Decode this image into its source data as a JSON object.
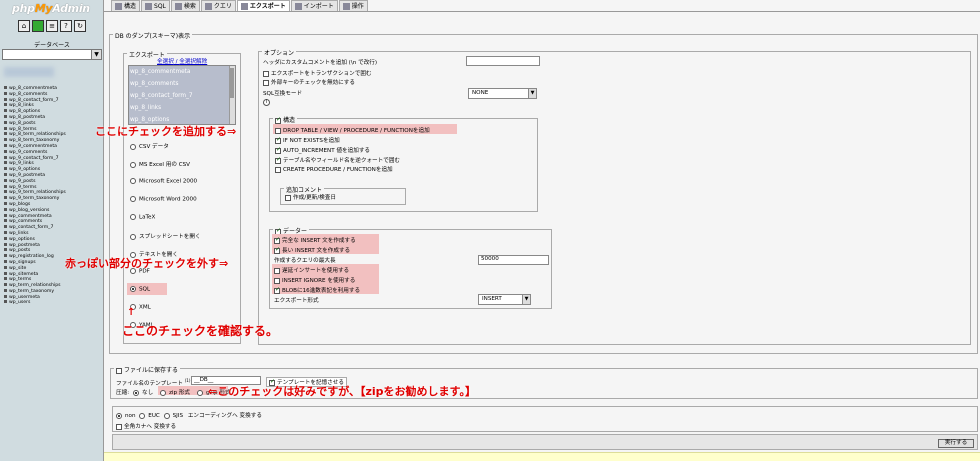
{
  "app": {
    "logo_prefix": "php",
    "logo_mid": "My",
    "logo_suffix": "Admin"
  },
  "left": {
    "db_label": "データベース",
    "icons": [
      "home-icon",
      "sql-window-icon",
      "docs-icon",
      "query-icon",
      "reload-icon"
    ],
    "tables": [
      "wp_8_commentmeta",
      "wp_8_comments",
      "wp_8_contact_form_7",
      "wp_8_links",
      "wp_8_options",
      "wp_8_postmeta",
      "wp_8_posts",
      "wp_8_terms",
      "wp_8_term_relationships",
      "wp_8_term_taxonomy",
      "wp_9_commentmeta",
      "wp_9_comments",
      "wp_9_contact_form_7",
      "wp_9_links",
      "wp_9_options",
      "wp_9_postmeta",
      "wp_9_posts",
      "wp_9_terms",
      "wp_9_term_relationships",
      "wp_9_term_taxonomy",
      "wp_blogs",
      "wp_blog_versions",
      "wp_commentmeta",
      "wp_comments",
      "wp_contact_form_7",
      "wp_links",
      "wp_options",
      "wp_postmeta",
      "wp_posts",
      "wp_registration_log",
      "wp_signups",
      "wp_site",
      "wp_sitemeta",
      "wp_terms",
      "wp_term_relationships",
      "wp_term_taxonomy",
      "wp_usermeta",
      "wp_users"
    ]
  },
  "tabs": [
    {
      "label": "構造",
      "active": false
    },
    {
      "label": "SQL",
      "active": false
    },
    {
      "label": "検索",
      "active": false
    },
    {
      "label": "クエリ",
      "active": false
    },
    {
      "label": "エクスポート",
      "active": true
    },
    {
      "label": "インポート",
      "active": false
    },
    {
      "label": "操作",
      "active": false
    }
  ],
  "dump": {
    "legend": "DB のダンプ(スキーマ)表示",
    "export_legend": "エクスポート",
    "select_all": "全選択",
    "sep": " / ",
    "deselect_all": "全選択解除",
    "table_items": [
      "wp_8_commentmeta",
      "wp_8_comments",
      "wp_8_contact_form_7",
      "wp_8_links",
      "wp_8_options"
    ],
    "formats": [
      "CSV データ",
      "MS Excel 用の CSV",
      "Microsoft Excel 2000",
      "Microsoft Word 2000",
      "LaTeX",
      "スプレッドシートを開く",
      "テキストを開く",
      "PDF",
      "SQL",
      "XML",
      "YAML"
    ],
    "selected_format": "SQL"
  },
  "options": {
    "legend": "オプション",
    "header_comment": "ヘッダにカスタムコメントを追加 (\\n で改行)",
    "transaction": "エクスポートをトランザクションで囲む",
    "fk_checks": "外部キーのチェックを無効にする",
    "compat_mode": "SQL互換モード",
    "compat_value": "NONE",
    "info": "i",
    "structure_legend": "構造",
    "drop_table": "DROP TABLE / VIEW / PROCEDURE / FUNCTIONを追加",
    "if_not_exists": "IF NOT EXISTSを追加",
    "auto_increment": "AUTO_INCREMENT 値を追加する",
    "backquotes": "テーブル名やフィールド名を逆クォートで囲む",
    "create_proc": "CREATE PROCEDURE / FUNCTIONを追加",
    "comment_legend": "追加コメント",
    "comment_dates": "作成/更新/検査日",
    "data_legend": "データー",
    "complete_insert": "完全な INSERT 文を作成する",
    "extended_insert": "長い INSERT 文を作成する",
    "max_query": "作成するクエリの最大長",
    "max_query_value": "50000",
    "delayed": "遅延インサートを使用する",
    "ignore": "INSERT IGNORE を使用する",
    "hex_blob": "BLOBに16進数表記を利用する",
    "export_type": "エクスポート形式",
    "export_type_value": "INSERT"
  },
  "file": {
    "save_label": "ファイルに保存する",
    "template_label": "ファイル名のテンプレート",
    "template_sup": "(1)",
    "template_value": "__DB__",
    "remember": "テンプレートを記憶させる",
    "compress_label": "圧縮:",
    "none": "なし",
    "zip": "zip 形式",
    "gzip": "gzip 形式"
  },
  "encoding": {
    "non": "non",
    "euc": "EUC",
    "sjis": "SJIS",
    "conv": "エンコーディングへ 変換する",
    "kana": "全角カナへ 変換する"
  },
  "exec_button": "実行する",
  "annotations": {
    "a1": "ここにチェックを追加する⇒",
    "a2": "赤っぽい部分のチェックを外す⇒",
    "a3_arrow": "↑",
    "a3": "ここのチェックを確認する。",
    "a4": "⇐このチェックは好みですが、【zipをお勧めします。】"
  }
}
